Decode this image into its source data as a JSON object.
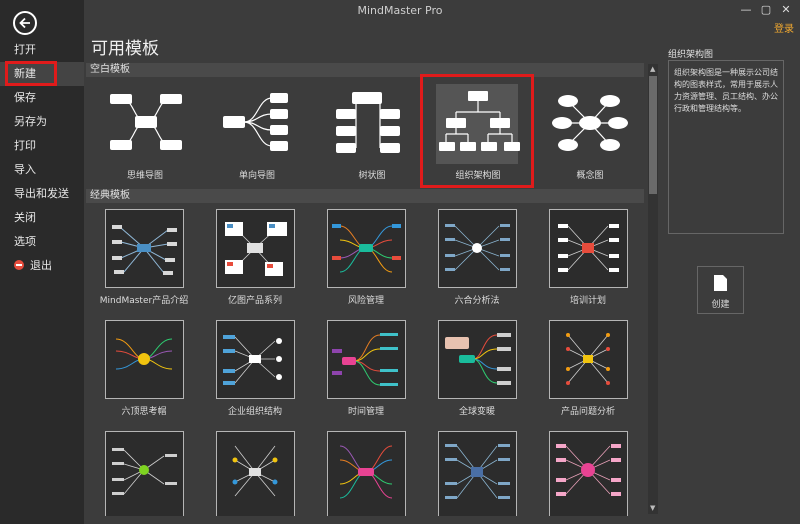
{
  "window": {
    "title": "MindMaster Pro",
    "minimize": "—",
    "restore": "▢",
    "close": "✕"
  },
  "sidebar": {
    "items": [
      {
        "label": "打开"
      },
      {
        "label": "新建"
      },
      {
        "label": "保存"
      },
      {
        "label": "另存为"
      },
      {
        "label": "打印"
      },
      {
        "label": "导入"
      },
      {
        "label": "导出和发送"
      },
      {
        "label": "关闭"
      },
      {
        "label": "选项"
      },
      {
        "label": "退出"
      }
    ]
  },
  "header": {
    "title": "可用模板",
    "login": "登录"
  },
  "blank_section": {
    "title": "空白模板",
    "items": [
      {
        "label": "思维导图"
      },
      {
        "label": "单向导图"
      },
      {
        "label": "树状图"
      },
      {
        "label": "组织架构图"
      },
      {
        "label": "概念图"
      }
    ]
  },
  "classic_section": {
    "title": "经典模板",
    "items": [
      {
        "label": "MindMaster产品介绍"
      },
      {
        "label": "亿图产品系列"
      },
      {
        "label": "风险管理"
      },
      {
        "label": "六合分析法"
      },
      {
        "label": "培训计划"
      },
      {
        "label": "六顶思考帽"
      },
      {
        "label": "企业组织结构"
      },
      {
        "label": "时间管理"
      },
      {
        "label": "全球变暖"
      },
      {
        "label": "产品问题分析"
      }
    ]
  },
  "preview": {
    "title": "组织架构图",
    "description": "组织架构图是一种展示公司结构的图表样式，常用于展示人力资源管理、员工结构、办公行政和管理结构等。",
    "create_label": "创建"
  },
  "colors": {
    "highlight": "#e01b1b",
    "login": "#f0a830"
  }
}
